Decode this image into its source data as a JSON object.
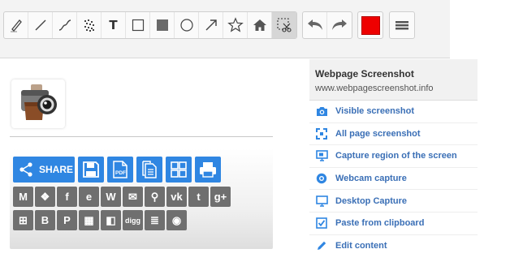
{
  "toolbar": {
    "tools": [
      {
        "icon": "pencil-icon"
      },
      {
        "icon": "line-icon"
      },
      {
        "icon": "curve-icon"
      },
      {
        "icon": "blur-icon"
      },
      {
        "icon": "text-icon",
        "label": "T"
      },
      {
        "icon": "rectangle-outline-icon"
      },
      {
        "icon": "rectangle-filled-icon"
      },
      {
        "icon": "circle-icon"
      },
      {
        "icon": "arrow-icon"
      },
      {
        "icon": "star-icon"
      },
      {
        "icon": "home-icon"
      },
      {
        "icon": "crop-cut-icon",
        "active": true
      }
    ],
    "history": [
      {
        "icon": "undo-icon"
      },
      {
        "icon": "redo-icon"
      }
    ],
    "color": "#ee0000",
    "menu_icon": "hamburger-icon"
  },
  "share": {
    "share_label": "SHARE",
    "pdf_label": "PDF",
    "primary_buttons": [
      "save-icon",
      "pdf-icon",
      "copy-icon",
      "grid-icon",
      "print-icon"
    ],
    "services_row1": [
      {
        "name": "gmail",
        "glyph": "M"
      },
      {
        "name": "dropbox",
        "glyph": "❖"
      },
      {
        "name": "facebook",
        "glyph": "f"
      },
      {
        "name": "evernote",
        "glyph": "e"
      },
      {
        "name": "wordpress",
        "glyph": "W"
      },
      {
        "name": "email",
        "glyph": "✉"
      },
      {
        "name": "search",
        "glyph": "⚲"
      },
      {
        "name": "vk",
        "glyph": "vk"
      },
      {
        "name": "tumblr",
        "glyph": "t"
      },
      {
        "name": "google-plus",
        "glyph": "g+"
      }
    ],
    "services_row2": [
      {
        "name": "windows",
        "glyph": "⊞"
      },
      {
        "name": "blogger",
        "glyph": "B"
      },
      {
        "name": "pinterest",
        "glyph": "P"
      },
      {
        "name": "qr-code",
        "glyph": "▦"
      },
      {
        "name": "delicious",
        "glyph": "◧"
      },
      {
        "name": "digg",
        "glyph": "digg"
      },
      {
        "name": "news",
        "glyph": "≣"
      },
      {
        "name": "reddit",
        "glyph": "◉"
      }
    ]
  },
  "menu": {
    "title": "Webpage Screenshot",
    "url": "www.webpagescreenshot.info",
    "items": [
      {
        "label": "Visible screenshot",
        "icon": "camera-icon"
      },
      {
        "label": "All page screenshot",
        "icon": "expand-icon"
      },
      {
        "label": "Capture region of the screen",
        "icon": "monitor-region-icon"
      },
      {
        "label": "Webcam capture",
        "icon": "webcam-icon"
      },
      {
        "label": "Desktop Capture",
        "icon": "desktop-icon"
      },
      {
        "label": "Paste from clipboard",
        "icon": "clipboard-icon"
      },
      {
        "label": "Edit content",
        "icon": "pencil-edit-icon"
      }
    ],
    "accent": "#3a6fb6",
    "icon_color": "#2f86e2"
  }
}
